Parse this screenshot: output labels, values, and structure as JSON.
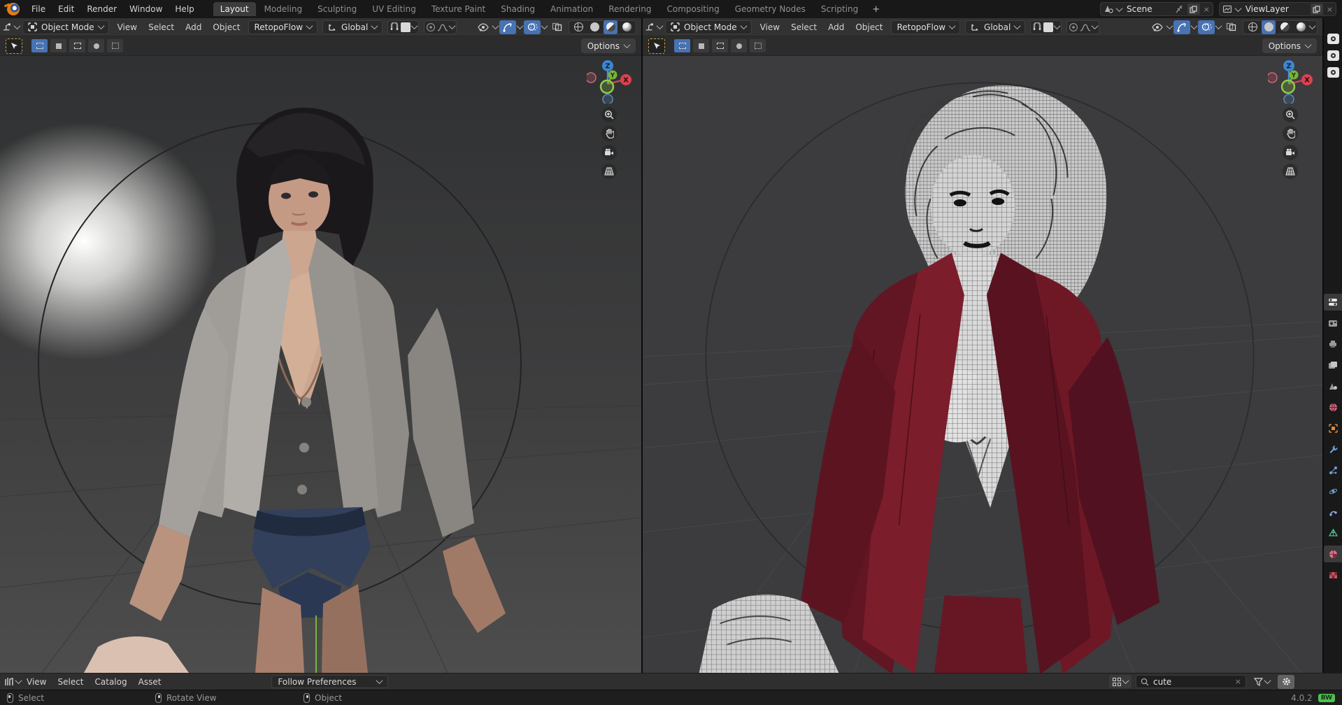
{
  "app": {
    "name": "Blender",
    "version": "4.0.2",
    "badge": "BW"
  },
  "topbar": {
    "menus": [
      "File",
      "Edit",
      "Render",
      "Window",
      "Help"
    ],
    "workspaces": [
      "Layout",
      "Modeling",
      "Sculpting",
      "UV Editing",
      "Texture Paint",
      "Shading",
      "Animation",
      "Rendering",
      "Compositing",
      "Geometry Nodes",
      "Scripting"
    ],
    "active_workspace": "Layout",
    "add_workspace_label": "+",
    "scene": {
      "label": "Scene"
    },
    "viewlayer": {
      "label": "ViewLayer"
    },
    "close_glyph": "×"
  },
  "viewports": [
    {
      "mode": "Object Mode",
      "menus": [
        "View",
        "Select",
        "Add",
        "Object"
      ],
      "plugin_menu": "RetopoFlow",
      "orientation": "Global",
      "options_label": "Options",
      "shading_active": "material-preview"
    },
    {
      "mode": "Object Mode",
      "menus": [
        "View",
        "Select",
        "Add",
        "Object"
      ],
      "plugin_menu": "RetopoFlow",
      "orientation": "Global",
      "options_label": "Options",
      "shading_active": "solid"
    }
  ],
  "gizmo": {
    "x_label": "X",
    "y_label": "Y",
    "z_label": "Z"
  },
  "asset_shelf": {
    "menus": [
      "View",
      "Select",
      "Catalog",
      "Asset"
    ],
    "import_method": "Follow Preferences",
    "search_value": "cute",
    "clear_glyph": "×"
  },
  "statusbar": {
    "hints": [
      {
        "button": "left-mouse",
        "label": "Select"
      },
      {
        "button": "middle-mouse",
        "label": "Rotate View"
      },
      {
        "button": "right-mouse",
        "label": "Object"
      }
    ],
    "version": "4.0.2",
    "badge": "BW"
  },
  "colors": {
    "accent_blue": "#4772b3",
    "axis_x_red": "#e0565e",
    "axis_y_green": "#78b33b",
    "axis_z_blue": "#4a8fd6",
    "tool_outline_yellow": "#c9a13c",
    "badge_green": "#4fc04f",
    "jacket_red": "#6b1620",
    "header_gray": "#323232"
  }
}
